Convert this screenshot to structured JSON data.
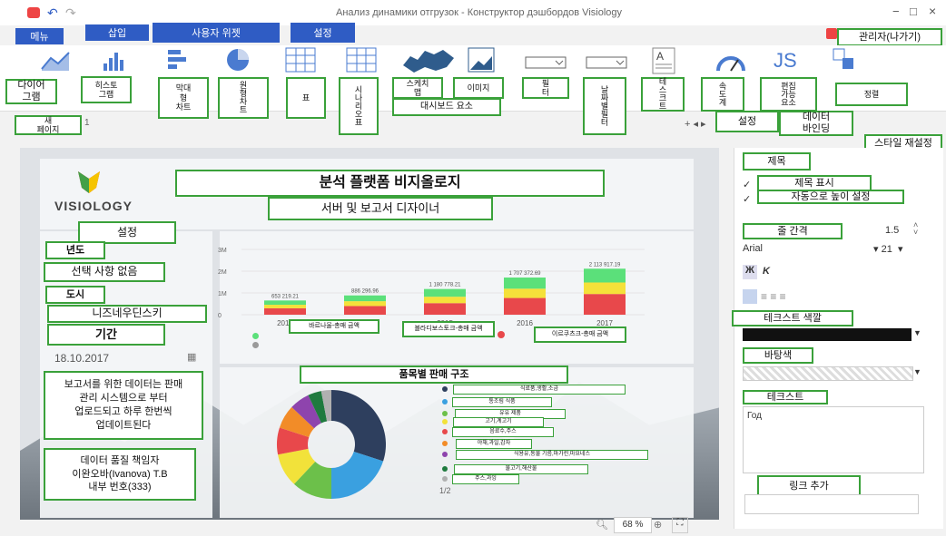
{
  "window": {
    "title": "Анализ динамики отгрузок - Конструктор дэшбордов Visiology",
    "controls": [
      "−",
      "□",
      "×"
    ]
  },
  "menu": {
    "tabs": [
      "메뉴",
      "삽입",
      "사용자 위젯",
      "설정"
    ],
    "admin": "관리자(나가기)"
  },
  "ribbon": {
    "items": [
      "다이어\n그램",
      "히스토\n그램",
      "막대\n형\n차트",
      "원\n형\n차\n트",
      "표",
      "시\n나\n리\n오\n표",
      "스케치\n맵",
      "이미지",
      "필\n터",
      "날\n짜\n별\n필\n터",
      "테\n스\n크\n트",
      "속\n도\n계",
      "편집\n가능\n요소",
      "정렬"
    ],
    "group_label": "대시보드 요소",
    "new_page": "새\n페이지",
    "page_tab": "1",
    "settings": "설정",
    "data_binding": "데이터\n바인딩",
    "style_reset": "스타일 재설정"
  },
  "dashboard": {
    "logo_text": "VISIOLOGY",
    "title": "분석 플랫폼 비지올로지",
    "subtitle": "서버 및 보고서 디자이너",
    "settings_label": "설정",
    "year_label": "년도",
    "year_value": "선택 사항 없음",
    "city_label": "도시",
    "city_value": "니즈네우딘스키",
    "period_label": "기간",
    "date_value": "18.10.2017",
    "note": "보고서를 위한 데이터는 판매\n관리 시스템으로 부터\n업로드되고 하루 한번씩\n업데이트된다",
    "owner": "데이터 품질 책임자\n이완오바(Ivanova) T.B\n내부 번호(333)",
    "zoom": "68"
  },
  "chart_data": [
    {
      "type": "bar",
      "categories": [
        "2013",
        "2014",
        "2015",
        "2016",
        "2017"
      ],
      "values": [
        653219.21,
        886296.96,
        1180778.21,
        1707372.69,
        2113917.19
      ],
      "data_labels": [
        "653 219.21",
        "886 296.96",
        "1 180 778.21",
        "1 707 372.69",
        "2 113 917.19"
      ],
      "y_ticks": [
        "3M",
        "2M",
        "1M",
        "0"
      ],
      "ylim": [
        0,
        3000000
      ],
      "legend": [
        "바르나울-총매 금액",
        "블라디보스토크-총매 금액",
        "이르쿠츠크-총매 금액"
      ],
      "colors": [
        "#5be07a",
        "#f5e13a",
        "#e8484b"
      ]
    },
    {
      "type": "pie",
      "title": "품목별 판매 구조",
      "labels": [
        "식료품,생활,소금",
        "통조림 식품",
        "유유 제품",
        "고기,계고기",
        "음료수,주스",
        "야채,과일,감자",
        "식용유,동물 기름,마가린,마요네스",
        "물고기,해산물",
        "주스,과잉"
      ],
      "values": [
        30,
        20,
        12,
        10,
        8,
        7,
        6,
        4,
        3
      ],
      "colors": [
        "#2e3f5e",
        "#3aa0e0",
        "#6cc04a",
        "#f2e23a",
        "#e8484b",
        "#f28c28",
        "#8e44ad",
        "#1f7a3e",
        "#b0b0b0"
      ],
      "page": "1/2"
    }
  ],
  "props": {
    "title_section": "제목",
    "show_title": "제목 표시",
    "auto_height": "자동으로 높이 설정",
    "line_spacing": "줄 간격",
    "line_spacing_value": "1.5",
    "font": "Arial",
    "font_size": "21",
    "text_color": "테크스트 색깔",
    "bg_color": "바탕색",
    "text_label": "테크스트",
    "text_value": "Год",
    "add_link": "링크 추가"
  }
}
